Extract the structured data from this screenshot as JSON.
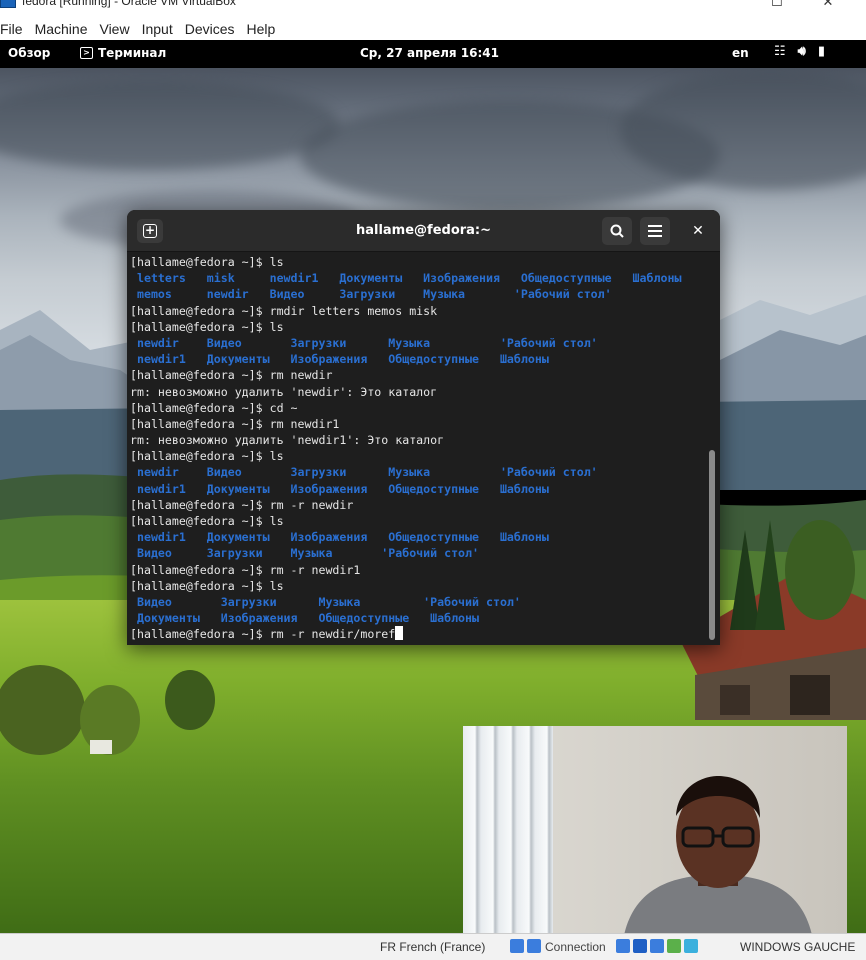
{
  "window": {
    "title": "fedora [Running] - Oracle VM VirtualBox",
    "controls": {
      "minimize": "—",
      "maximize": "☐",
      "close": "✕"
    }
  },
  "vbox_menu": [
    "File",
    "Machine",
    "View",
    "Input",
    "Devices",
    "Help"
  ],
  "gnome_topbar": {
    "overview": "Обзор",
    "app": "Терминал",
    "clock": "Ср, 27 апреля  16:41",
    "lang": "en",
    "icons": [
      "network-icon",
      "volume-icon",
      "battery-icon"
    ]
  },
  "terminal": {
    "title": "hallame@fedora:~",
    "lines": [
      [
        {
          "t": "[hallame@fedora ~]$ ls",
          "c": "txt"
        }
      ],
      [
        {
          "t": " letters   misk     newdir1   Документы   Изображения   Общедоступные   Шаблоны",
          "c": "dir"
        }
      ],
      [
        {
          "t": " memos     newdir   Видео     Загрузки    Музыка       'Рабочий стол'",
          "c": "dir"
        }
      ],
      [
        {
          "t": "[hallame@fedora ~]$ rmdir letters memos misk",
          "c": "txt"
        }
      ],
      [
        {
          "t": "[hallame@fedora ~]$ ls",
          "c": "txt"
        }
      ],
      [
        {
          "t": " newdir    Видео       Загрузки      Музыка          'Рабочий стол'",
          "c": "dir"
        }
      ],
      [
        {
          "t": " newdir1   Документы   Изображения   Общедоступные   Шаблоны",
          "c": "dir"
        }
      ],
      [
        {
          "t": "[hallame@fedora ~]$ rm newdir",
          "c": "txt"
        }
      ],
      [
        {
          "t": "rm: невозможно удалить 'newdir': Это каталог",
          "c": "txt"
        }
      ],
      [
        {
          "t": "[hallame@fedora ~]$ cd ~",
          "c": "txt"
        }
      ],
      [
        {
          "t": "[hallame@fedora ~]$ rm newdir1",
          "c": "txt"
        }
      ],
      [
        {
          "t": "rm: невозможно удалить 'newdir1': Это каталог",
          "c": "txt"
        }
      ],
      [
        {
          "t": "[hallame@fedora ~]$ ls",
          "c": "txt"
        }
      ],
      [
        {
          "t": " newdir    Видео       Загрузки      Музыка          'Рабочий стол'",
          "c": "dir"
        }
      ],
      [
        {
          "t": " newdir1   Документы   Изображения   Общедоступные   Шаблоны",
          "c": "dir"
        }
      ],
      [
        {
          "t": "[hallame@fedora ~]$ rm -r newdir",
          "c": "txt"
        }
      ],
      [
        {
          "t": "[hallame@fedora ~]$ ls",
          "c": "txt"
        }
      ],
      [
        {
          "t": " newdir1   Документы   Изображения   Общедоступные   Шаблоны",
          "c": "dir"
        }
      ],
      [
        {
          "t": " Видео     Загрузки    Музыка       'Рабочий стол'",
          "c": "dir"
        }
      ],
      [
        {
          "t": "[hallame@fedora ~]$ rm -r newdir1",
          "c": "txt"
        }
      ],
      [
        {
          "t": "[hallame@fedora ~]$ ls",
          "c": "txt"
        }
      ],
      [
        {
          "t": " Видео       Загрузки      Музыка         'Рабочий стол'",
          "c": "dir"
        }
      ],
      [
        {
          "t": " Документы   Изображения   Общедоступные   Шаблоны",
          "c": "dir"
        }
      ],
      [
        {
          "t": "[hallame@fedora ~]$ rm -r newdir/moref",
          "c": "txt"
        }
      ]
    ]
  },
  "host_taskbar": {
    "kb_lang": "FR French (France)",
    "tray_label": "Connection",
    "layout": "WINDOWS GAUCHE"
  },
  "colors": {
    "dir_blue": "#2a6fd1",
    "terminal_bg": "#1e1e1e",
    "header_bg": "#2b2b2b"
  }
}
